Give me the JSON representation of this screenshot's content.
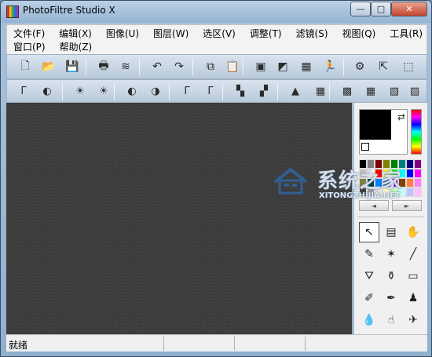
{
  "window": {
    "title": "PhotoFiltre Studio X",
    "buttons": {
      "minimize": "—",
      "maximize": "□",
      "close": "✕"
    }
  },
  "menubar": {
    "row1": [
      "文件(F)",
      "编辑(X)",
      "图像(U)",
      "图层(W)",
      "选区(V)",
      "调整(T)",
      "滤镜(S)",
      "视图(Q)",
      "工具(R)"
    ],
    "row2": [
      "窗口(P)",
      "帮助(Z)"
    ]
  },
  "toolbar1": {
    "icons": [
      "new-file-icon",
      "open-folder-icon",
      "save-icon",
      "print-icon",
      "scan-icon",
      "undo-icon",
      "redo-icon",
      "copy-icon",
      "paste-icon",
      "crop-icon",
      "gradient-icon",
      "pattern-icon",
      "run-icon",
      "automate-icon",
      "export-icon",
      "selection-icon"
    ],
    "glyphs": [
      "🗋",
      "📂",
      "💾",
      "🖶",
      "≋",
      "↶",
      "↷",
      "⧉",
      "📋",
      "▣",
      "◩",
      "▦",
      "🏃",
      "⚙",
      "⇱",
      "⬚"
    ]
  },
  "toolbar2": {
    "icons": [
      "gamma-auto-icon",
      "contrast-auto-icon",
      "brightness-minus-icon",
      "brightness-plus-icon",
      "contrast-minus-icon",
      "contrast-plus-icon",
      "gamma-minus-icon",
      "gamma-plus-icon",
      "saturation-minus-icon",
      "saturation-plus-icon",
      "sharpen-icon",
      "texture-icon",
      "mosaic-icon",
      "pixelate-icon",
      "blur-icon",
      "noise-icon"
    ],
    "glyphs": [
      "Γ",
      "◐",
      "☀",
      "☀",
      "◐",
      "◑",
      "Γ",
      "Γ",
      "▚",
      "▞",
      "▲",
      "▦",
      "▩",
      "▦",
      "▧",
      "▨"
    ]
  },
  "colors": {
    "foreground": "#000000",
    "palette": [
      "#000000",
      "#808080",
      "#800000",
      "#808000",
      "#008000",
      "#008080",
      "#000080",
      "#800080",
      "#c0c0c0",
      "#ffffff",
      "#ff0000",
      "#ffff00",
      "#00ff00",
      "#00ffff",
      "#0000ff",
      "#ff00ff",
      "#808040",
      "#004040",
      "#0080ff",
      "#004080",
      "#8000ff",
      "#804000",
      "#ff8040",
      "#ff80ff",
      "#404040",
      "#a0a0a0",
      "#e0e0e0",
      "#ffffc0",
      "#c0ffc0",
      "#c0ffff",
      "#c0c0ff",
      "#ffc0ff"
    ],
    "palette_nav": [
      "◄",
      "►"
    ]
  },
  "tools": {
    "icons": [
      "pointer-icon",
      "image-tube-icon",
      "hand-icon",
      "eyedropper-icon",
      "magic-wand-icon",
      "line-icon",
      "fill-bucket-icon",
      "spray-icon",
      "eraser-icon",
      "brush-icon",
      "advanced-brush-icon",
      "clone-stamp-icon",
      "blur-drop-icon",
      "smudge-icon",
      "deform-icon"
    ],
    "glyphs": [
      "↖",
      "▤",
      "✋",
      "✎",
      "✶",
      "╱",
      "⛛",
      "⚱",
      "▭",
      "✐",
      "✒",
      "♟",
      "💧",
      "☝",
      "✈"
    ]
  },
  "status": {
    "text": "就绪"
  },
  "watermark": {
    "cn": "系统之家",
    "en": "XITONGZHIJIA.NET"
  }
}
